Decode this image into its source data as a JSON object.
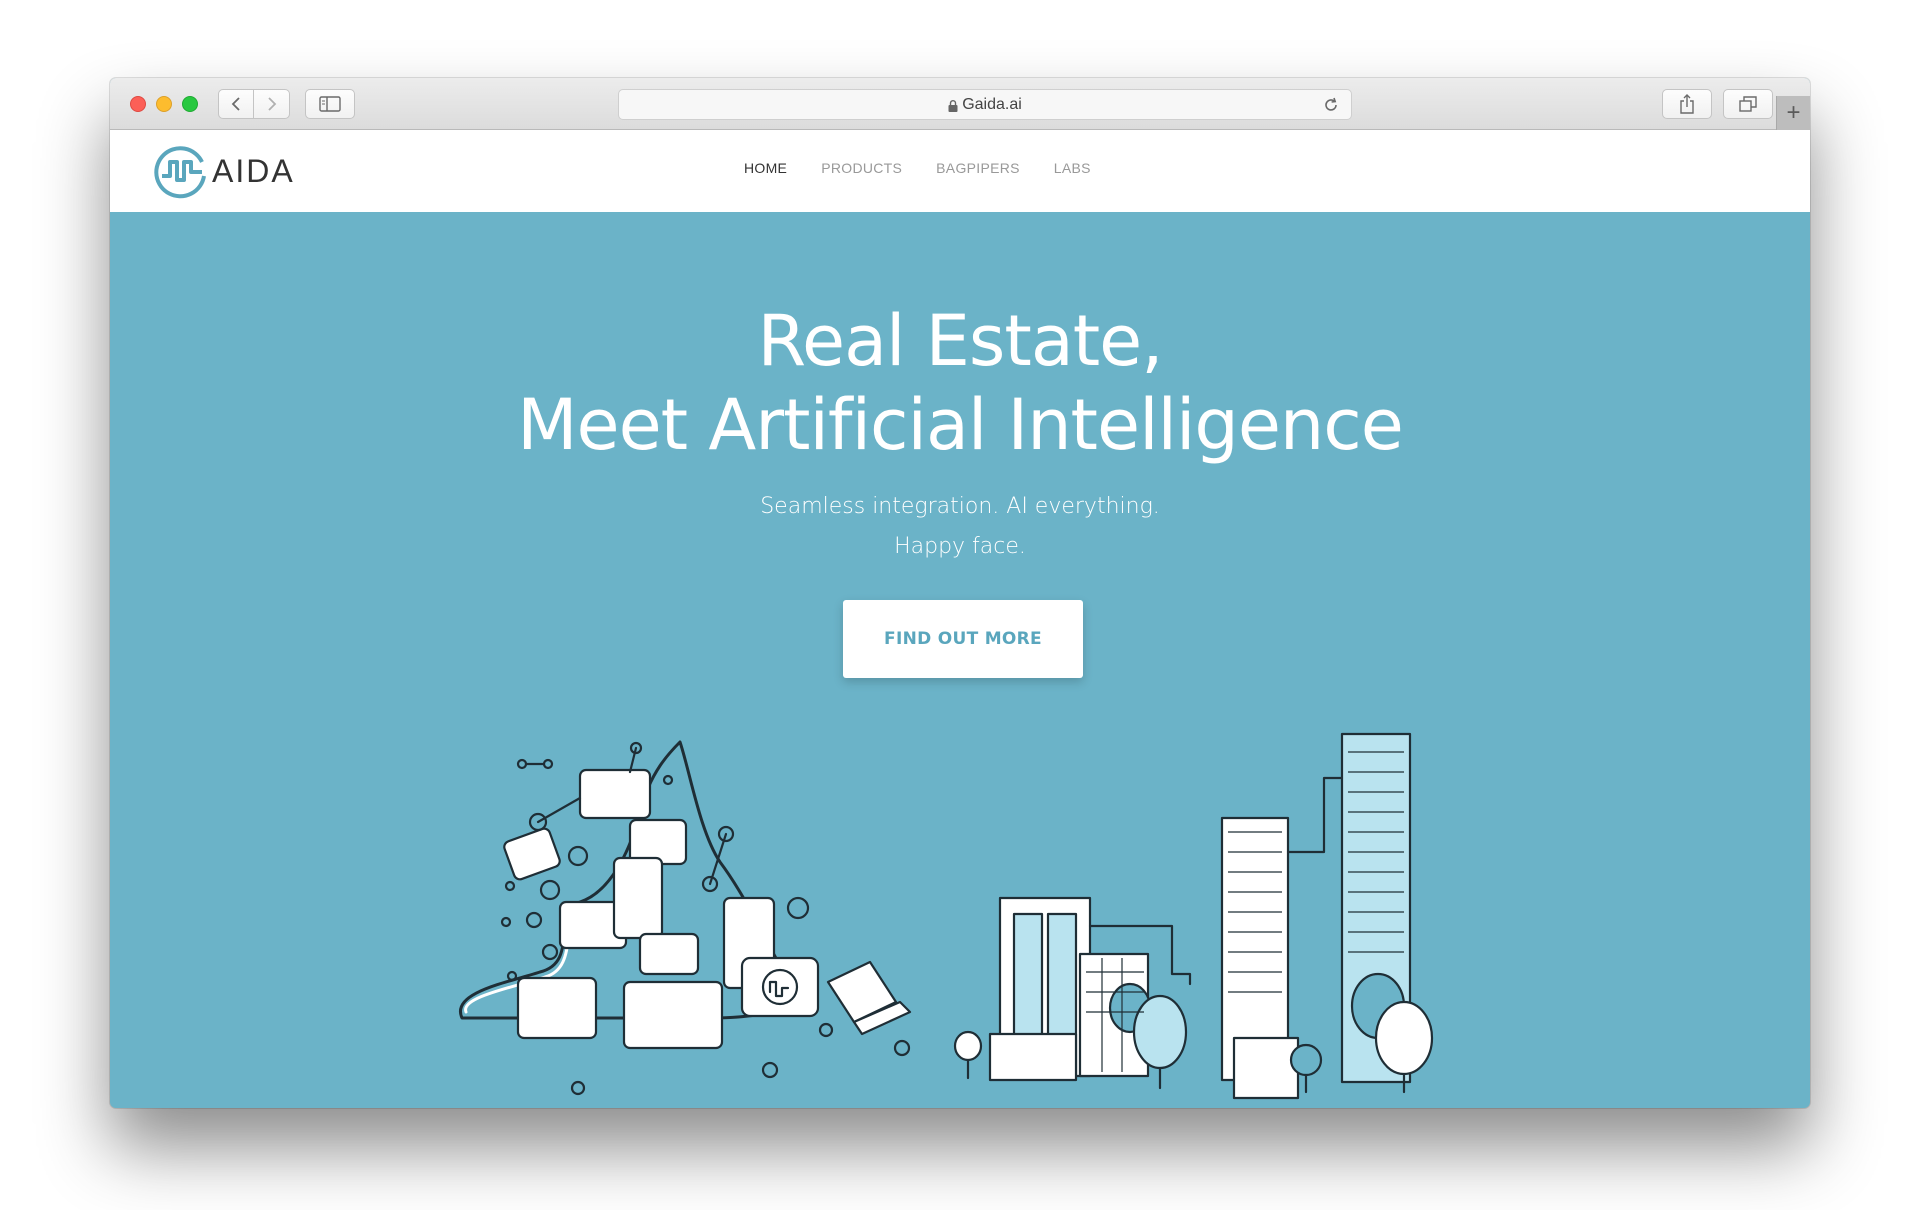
{
  "browser": {
    "url": "Gaida.ai",
    "back_icon": "chevron-left-icon",
    "forward_icon": "chevron-right-icon",
    "new_tab_label": "+"
  },
  "site": {
    "logo_text": "AIDA",
    "nav": [
      {
        "label": "HOME",
        "active": true
      },
      {
        "label": "PRODUCTS",
        "active": false
      },
      {
        "label": "BAGPIPERS",
        "active": false
      },
      {
        "label": "LABS",
        "active": false
      }
    ]
  },
  "hero": {
    "title_line1": "Real Estate,",
    "title_line2": "Meet Artificial Intelligence",
    "subtitle_line1": "Seamless integration. AI everything.",
    "subtitle_line2": "Happy face.",
    "cta_label": "FIND OUT MORE"
  },
  "colors": {
    "hero_background": "#6bb3c8",
    "cta_text": "#5aa6bd",
    "illustration_fill": "#b9e3ef"
  }
}
